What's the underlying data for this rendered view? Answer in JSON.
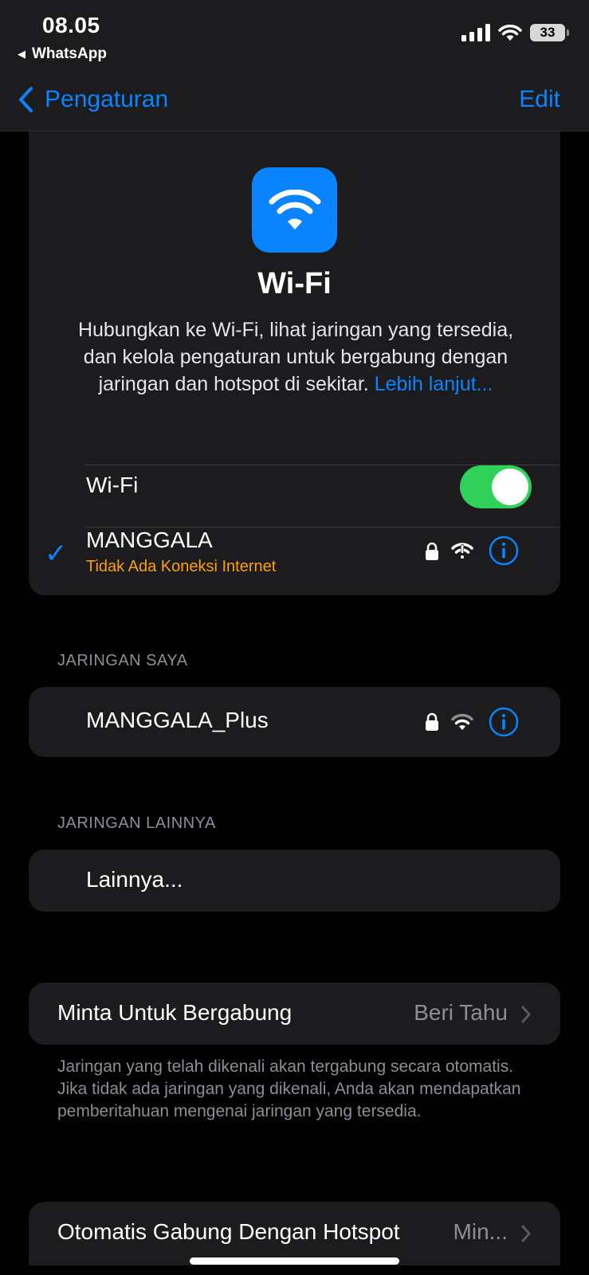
{
  "status_bar": {
    "time": "08.05",
    "back_app": "WhatsApp",
    "battery": "33"
  },
  "nav": {
    "back_label": "Pengaturan",
    "edit_label": "Edit"
  },
  "hero": {
    "title": "Wi-Fi",
    "description": "Hubungkan ke Wi-Fi, lihat jaringan yang tersedia, dan kelola pengaturan untuk bergabung dengan jaringan dan hotspot di sekitar.",
    "more_link": "Lebih lanjut..."
  },
  "wifi_toggle": {
    "label": "Wi-Fi",
    "on": true
  },
  "connected": {
    "name": "MANGGALA",
    "status": "Tidak Ada Koneksi Internet"
  },
  "my_networks": {
    "header": "JARINGAN SAYA",
    "items": [
      {
        "name": "MANGGALA_Plus"
      }
    ]
  },
  "other_networks": {
    "header": "JARINGAN LAINNYA",
    "other_label": "Lainnya..."
  },
  "ask_to_join": {
    "label": "Minta Untuk Bergabung",
    "value": "Beri Tahu",
    "footer": "Jaringan yang telah dikenali akan tergabung secara otomatis. Jika tidak ada jaringan yang dikenali, Anda akan mendapatkan pemberitahuan mengenai jaringan yang tersedia."
  },
  "auto_join_hotspot": {
    "label": "Otomatis Gabung Dengan Hotspot",
    "value": "Min..."
  },
  "colors": {
    "accent": "#0a84ff",
    "toggle_on": "#30d158",
    "warning": "#ff9f0a",
    "card_bg": "#1c1c1e"
  }
}
